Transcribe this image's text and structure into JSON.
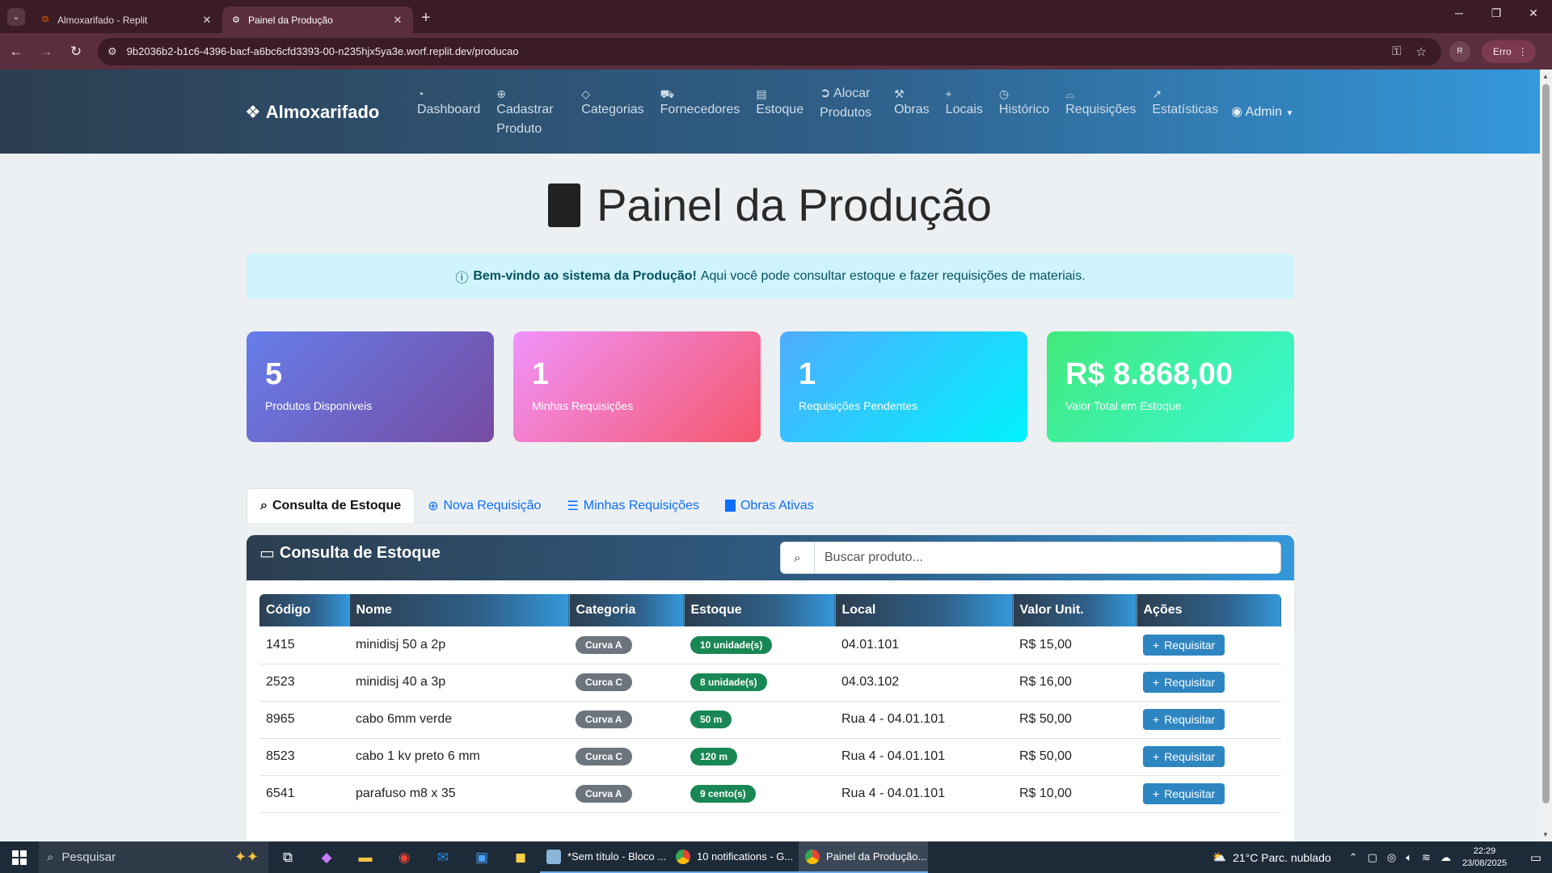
{
  "browser": {
    "tabs": [
      {
        "title": "Almoxarifado - Replit",
        "icon": "replit-icon",
        "active": false
      },
      {
        "title": "Painel da Produção",
        "icon": "site-icon",
        "active": true
      }
    ],
    "url": "9b2036b2-b1c6-4396-bacf-a6bc6cfd3393-00-n235hjx5ya3e.worf.replit.dev/producao",
    "profile_initial": "R",
    "error_label": "Erro"
  },
  "app": {
    "brand": "Almoxarifado",
    "nav": [
      {
        "label": "Dashboard",
        "icon": "dashboard-icon"
      },
      {
        "label": "Cadastrar Produto",
        "icon": "plus-circle-icon"
      },
      {
        "label": "Categorias",
        "icon": "tag-icon"
      },
      {
        "label": "Fornecedores",
        "icon": "truck-icon"
      },
      {
        "label": "Estoque",
        "icon": "archive-icon"
      },
      {
        "label": "Alocar Produtos",
        "icon": "arrow-circle-icon"
      },
      {
        "label": "Obras",
        "icon": "hammer-icon"
      },
      {
        "label": "Locais",
        "icon": "location-pin-icon"
      },
      {
        "label": "Histórico",
        "icon": "clock-icon"
      },
      {
        "label": "Requisições",
        "icon": "inbox-icon"
      },
      {
        "label": "Estatísticas",
        "icon": "chart-icon"
      }
    ],
    "admin_label": "Admin"
  },
  "page": {
    "title": "Painel da Produção",
    "alert_bold": "Bem-vindo ao sistema da Produção!",
    "alert_text": "Aqui você pode consultar estoque e fazer requisições de materiais.",
    "cards": [
      {
        "value": "5",
        "label": "Produtos Disponíveis"
      },
      {
        "value": "1",
        "label": "Minhas Requisições"
      },
      {
        "value": "1",
        "label": "Requisições Pendentes"
      },
      {
        "value": "R$ 8.868,00",
        "label": "Valor Total em Estoque"
      }
    ],
    "tabs": [
      {
        "label": "Consulta de Estoque",
        "active": true
      },
      {
        "label": "Nova Requisição",
        "active": false
      },
      {
        "label": "Minhas Requisições",
        "active": false
      },
      {
        "label": "Obras Ativas",
        "active": false
      }
    ],
    "panel_title": "Consulta de Estoque",
    "search_placeholder": "Buscar produto...",
    "table": {
      "headers": [
        "Código",
        "Nome",
        "Categoria",
        "Estoque",
        "Local",
        "Valor Unit.",
        "Ações"
      ],
      "rows": [
        {
          "code": "1415",
          "name": "minidisj 50 a 2p",
          "category": "Curva A",
          "stock": "10 unidade(s)",
          "location": "04.01.101",
          "price": "R$ 15,00",
          "action": "Requisitar"
        },
        {
          "code": "2523",
          "name": "minidisj 40 a 3p",
          "category": "Curca C",
          "stock": "8 unidade(s)",
          "location": "04.03.102",
          "price": "R$ 16,00",
          "action": "Requisitar"
        },
        {
          "code": "8965",
          "name": "cabo 6mm verde",
          "category": "Curva A",
          "stock": "50 m",
          "location": "Rua 4 - 04.01.101",
          "price": "R$ 50,00",
          "action": "Requisitar"
        },
        {
          "code": "8523",
          "name": "cabo 1 kv preto 6 mm",
          "category": "Curca C",
          "stock": "120 m",
          "location": "Rua 4 - 04.01.101",
          "price": "R$ 50,00",
          "action": "Requisitar"
        },
        {
          "code": "6541",
          "name": "parafuso m8 x 35",
          "category": "Curva A",
          "stock": "9 cento(s)",
          "location": "Rua 4 - 04.01.101",
          "price": "R$ 10,00",
          "action": "Requisitar"
        }
      ]
    }
  },
  "taskbar": {
    "search_placeholder": "Pesquisar",
    "apps": [
      {
        "label": "*Sem título - Bloco ...",
        "active": false
      },
      {
        "label": "10 notifications - G...",
        "active": false
      },
      {
        "label": "Painel da Produção...",
        "active": true
      }
    ],
    "weather": "21°C  Parc. nublado",
    "time": "22:29",
    "date": "23/08/2025"
  }
}
